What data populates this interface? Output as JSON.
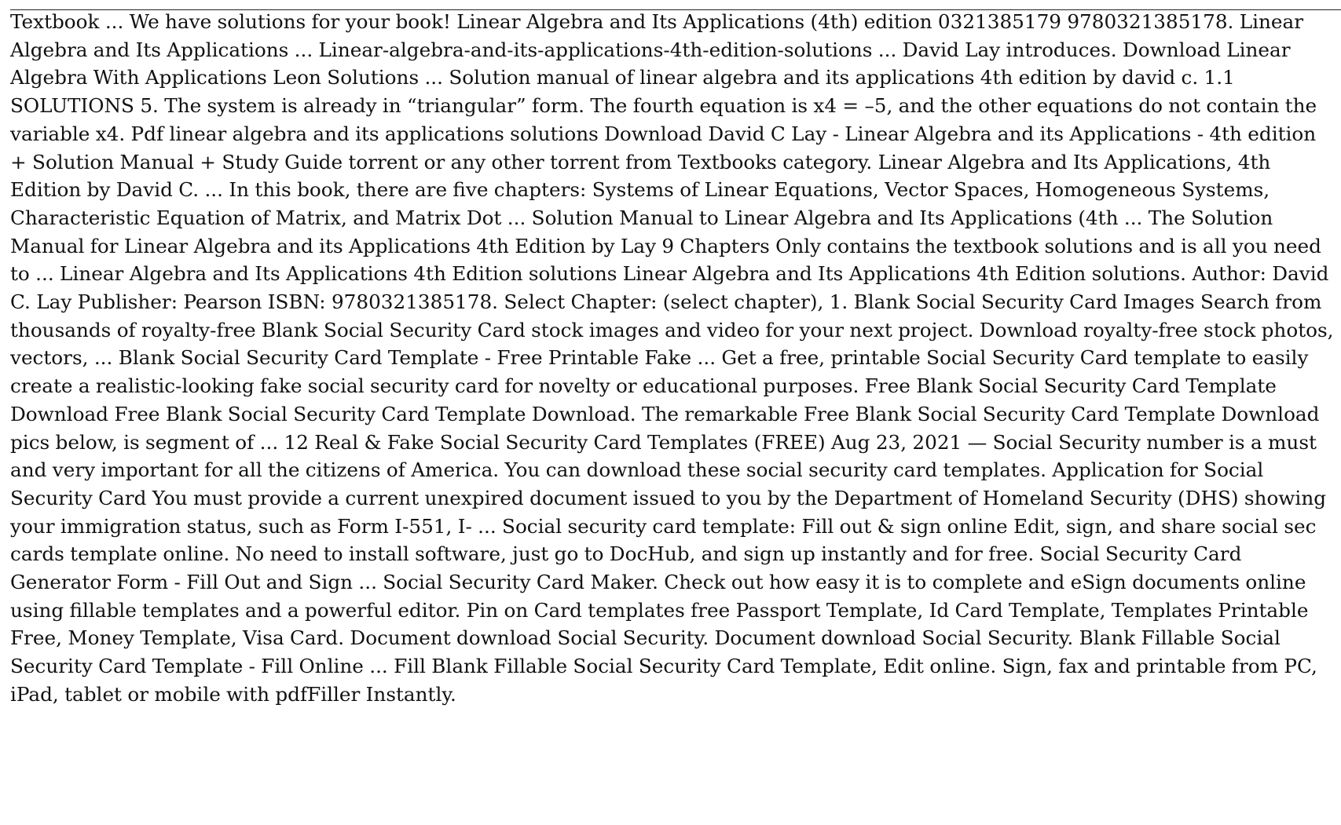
{
  "document": {
    "text": "Textbook ... We have solutions for your book! Linear Algebra and Its Applications (4th) edition 0321385179 9780321385178. Linear Algebra and Its Applications ... Linear-algebra-and-its-applications-4th-edition-solutions ... David Lay introduces. Download Linear Algebra With Applications Leon Solutions ... Solution manual of linear algebra and its applications 4th edition by david c. 1.1 SOLUTIONS 5. The system is already in “triangular” form. The fourth equation is x4 = –5, and the other equations do not contain the variable x4. Pdf linear algebra and its applications solutions Download David C Lay - Linear Algebra and its Applications - 4th edition + Solution Manual + Study Guide torrent or any other torrent from Textbooks category. Linear Algebra and Its Applications, 4th Edition by David C. ... In this book, there are five chapters: Systems of Linear Equations, Vector Spaces, Homogeneous Systems, Characteristic Equation of Matrix, and Matrix Dot ... Solution Manual to Linear Algebra and Its Applications (4th ... The Solution Manual for Linear Algebra and its Applications 4th Edition by Lay 9 Chapters Only contains the textbook solutions and is all you need to ... Linear Algebra and Its Applications 4th Edition solutions Linear Algebra and Its Applications 4th Edition solutions. Author: David C. Lay Publisher: Pearson ISBN: 9780321385178. Select Chapter: (select chapter), 1. Blank Social Security Card Images Search from thousands of royalty-free Blank Social Security Card stock images and video for your next project. Download royalty-free stock photos, vectors, ... Blank Social Security Card Template - Free Printable Fake ... Get a free, printable Social Security Card template to easily create a realistic-looking fake social security card for novelty or educational purposes. Free Blank Social Security Card Template Download Free Blank Social Security Card Template Download. The remarkable Free Blank Social Security Card Template Download pics below, is segment of ... 12 Real & Fake Social Security Card Templates (FREE) Aug 23, 2021 — Social Security number is a must and very important for all the citizens of America. You can download these social security card templates. Application for Social Security Card You must provide a current unexpired document issued to you by the Department of Homeland Security (DHS) showing your immigration status, such as Form I-551, I- ... Social security card template: Fill out & sign online Edit, sign, and share social sec cards template online. No need to install software, just go to DocHub, and sign up instantly and for free. Social Security Card Generator Form - Fill Out and Sign ... Social Security Card Maker. Check out how easy it is to complete and eSign documents online using fillable templates and a powerful editor. Pin on Card templates free Passport Template, Id Card Template, Templates Printable Free, Money Template, Visa Card. Document download Social Security. Document download Social Security. Blank Fillable Social Security Card Template - Fill Online ... Fill Blank Fillable Social Security Card Template, Edit online. Sign, fax and printable from PC, iPad, tablet or mobile with pdfFiller  Instantly."
  },
  "colors": {
    "text": "#111111",
    "background": "#ffffff",
    "rule": "#222222"
  }
}
